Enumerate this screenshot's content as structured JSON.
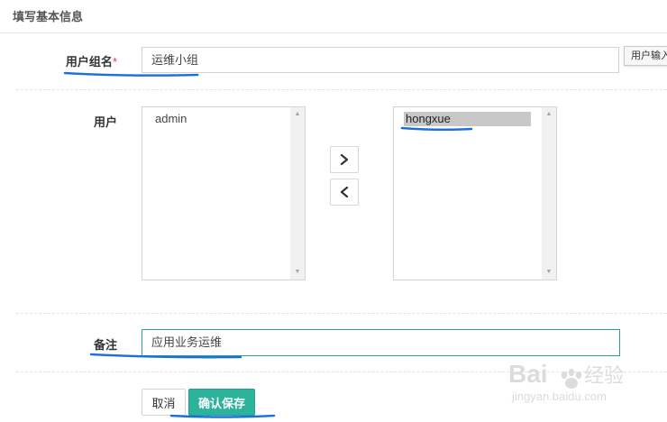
{
  "section": {
    "title": "填写基本信息"
  },
  "form": {
    "group_name": {
      "label": "用户组名",
      "required_mark": "*",
      "value": "运维小组",
      "tooltip": "用户输入"
    },
    "users": {
      "label": "用户",
      "available": [
        "admin"
      ],
      "selected": [
        "hongxue"
      ],
      "selected_highlight": "hongxue"
    },
    "remark": {
      "label": "备注",
      "value": "应用业务运维"
    }
  },
  "actions": {
    "cancel_label": "取消",
    "confirm_label": "确认保存"
  },
  "icons": {
    "move_right": "chevron-right-icon",
    "move_left": "chevron-left-icon",
    "scroll_up": "triangle-up-icon",
    "scroll_down": "triangle-down-icon"
  },
  "watermark": {
    "brand": "Bai",
    "brand_suffix": "经验",
    "url": "jingyan.baidu.com"
  },
  "colors": {
    "primary": "#2bb39b",
    "focus_border": "#2aa09a",
    "required": "#e4393c",
    "annotation": "#1a6fd8",
    "selection": "#c8c8c8"
  }
}
